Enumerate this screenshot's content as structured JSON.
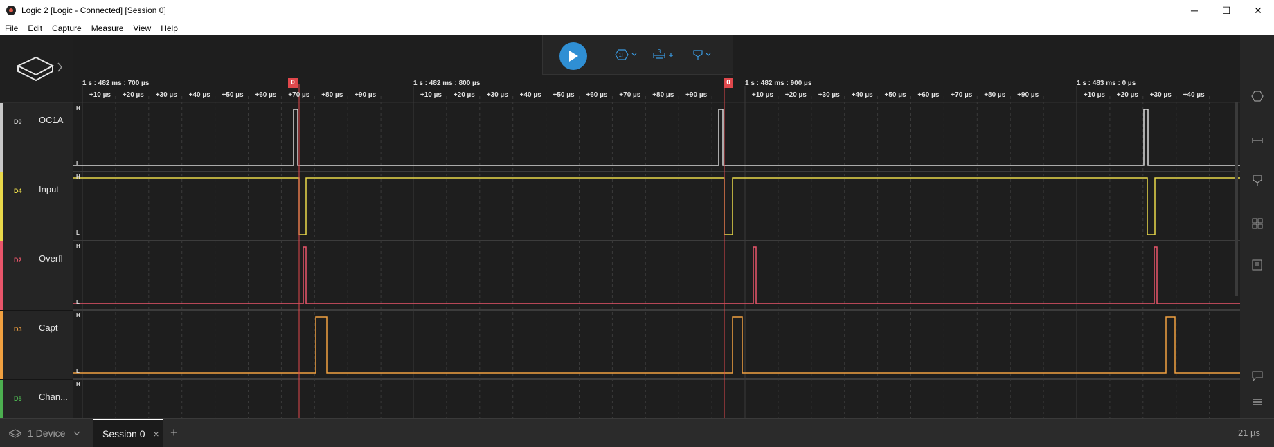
{
  "window": {
    "title": "Logic 2 [Logic - Connected] [Session 0]",
    "minimize_glyph": "─",
    "maximize_glyph": "☐",
    "close_glyph": "✕"
  },
  "menu": [
    "File",
    "Edit",
    "Capture",
    "Measure",
    "View",
    "Help"
  ],
  "toolbar": {
    "trigger_label": "1F",
    "measure_label": "3"
  },
  "timeline": {
    "major": [
      {
        "label": "1 s : 482 ms : 700 µs"
      },
      {
        "label": "1 s : 482 ms : 800 µs"
      },
      {
        "label": "1 s : 482 ms : 900 µs"
      },
      {
        "label": "1 s : 483 ms : 0 µs"
      }
    ],
    "minor_labels": [
      "+10 µs",
      "+20 µs",
      "+30 µs",
      "+40 µs",
      "+50 µs",
      "+60 µs",
      "+70 µs",
      "+80 µs",
      "+90 µs"
    ],
    "markers": [
      {
        "label": "0"
      },
      {
        "label": "0"
      }
    ]
  },
  "channels": [
    {
      "num": "D0",
      "name": "OC1A",
      "color": "#c8c8c8"
    },
    {
      "num": "D4",
      "name": "Input",
      "color": "#e8d84a"
    },
    {
      "num": "D2",
      "name": "Overfl",
      "color": "#e8556a"
    },
    {
      "num": "D3",
      "name": "Capt",
      "color": "#f0a040"
    },
    {
      "num": "D5",
      "name": "Chan...",
      "color": "#4caf50"
    }
  ],
  "level_labels": {
    "high": "H",
    "low": "L"
  },
  "bottom": {
    "device_label": "1 Device",
    "session_label": "Session 0",
    "close_glyph": "×",
    "add_glyph": "+",
    "zoom": "21 µs"
  },
  "colors": {
    "accent": "#2f8fd4",
    "marker": "#e0484c"
  }
}
